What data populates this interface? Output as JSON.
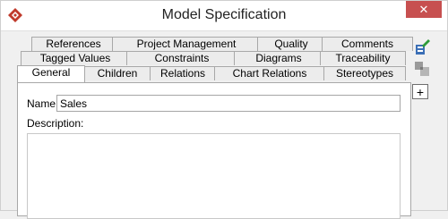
{
  "window": {
    "title": "Model Specification",
    "close_glyph": "✕",
    "app_icon": "visual-paradigm-logo-icon"
  },
  "tabs": {
    "row1": [
      "References",
      "Project Management",
      "Quality",
      "Comments"
    ],
    "row2": [
      "Tagged Values",
      "Constraints",
      "Diagrams",
      "Traceability"
    ],
    "row3": [
      "General",
      "Children",
      "Relations",
      "Chart Relations",
      "Stereotypes"
    ],
    "active": "General"
  },
  "general": {
    "name_label": "Name:",
    "name_value": "Sales",
    "description_label": "Description:",
    "description_value": ""
  },
  "side_toolbar": {
    "icons": [
      "edit-model-icon",
      "copy-shapes-icon"
    ],
    "expand_glyph": "+"
  },
  "colors": {
    "close_button": "#c75050",
    "window_bg": "#f0f0f0",
    "panel_bg": "#ffffff",
    "logo_red": "#c0392b",
    "accent_green": "#2e9b3a"
  }
}
